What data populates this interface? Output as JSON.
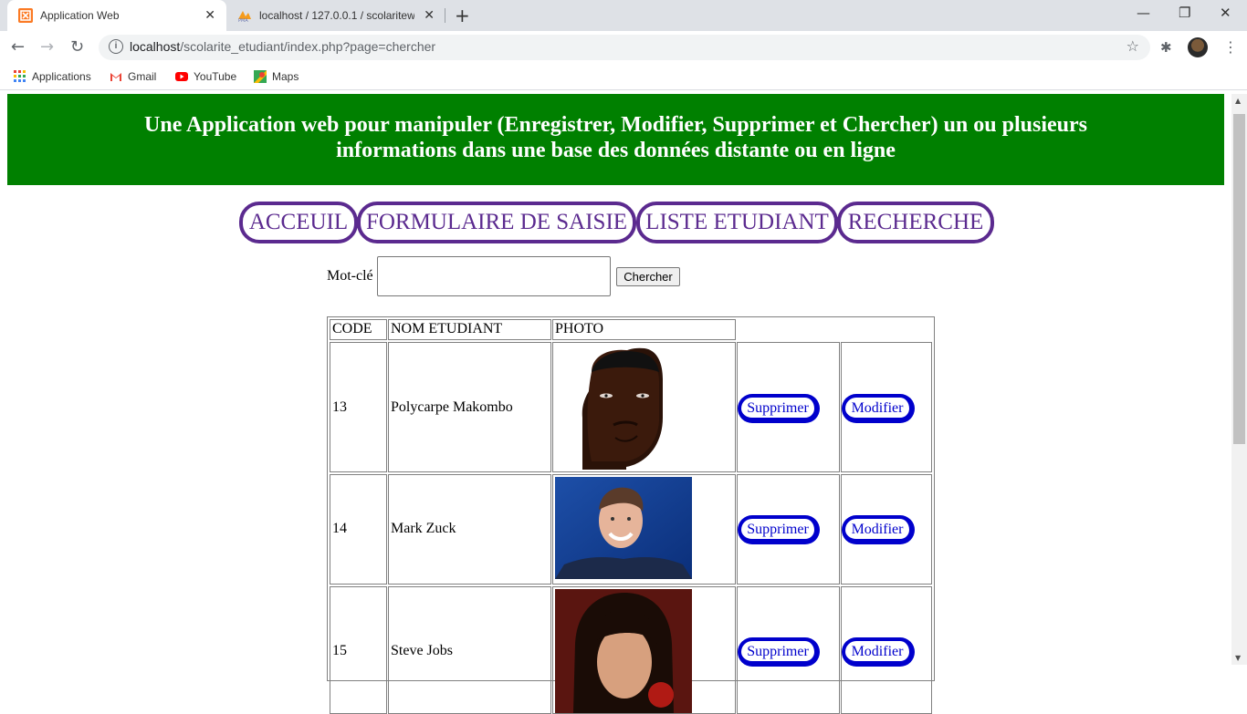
{
  "browser": {
    "tabs": [
      {
        "title": "Application Web",
        "active": true,
        "favicon": "xampp-icon"
      },
      {
        "title": "localhost / 127.0.0.1 / scolaritewe",
        "active": false,
        "favicon": "phpmyadmin-icon"
      }
    ],
    "url_host": "localhost",
    "url_path": "/scolarite_etudiant/index.php?page=chercher",
    "bookmarks": [
      {
        "label": "Applications",
        "icon": "apps-grid-icon"
      },
      {
        "label": "Gmail",
        "icon": "gmail-icon"
      },
      {
        "label": "YouTube",
        "icon": "youtube-icon"
      },
      {
        "label": "Maps",
        "icon": "maps-icon"
      }
    ]
  },
  "page": {
    "banner_line1": "Une Application web pour manipuler (Enregistrer, Modifier, Supprimer et Chercher) un ou plusieurs",
    "banner_line2": "informations dans une base des données distante ou en ligne",
    "nav": [
      "ACCEUIL",
      "FORMULAIRE DE SAISIE",
      "LISTE ETUDIANT",
      "RECHERCHE"
    ],
    "search": {
      "label": "Mot-clé",
      "value": "",
      "button": "Chercher"
    },
    "table": {
      "headers": [
        "CODE",
        "NOM ETUDIANT",
        "PHOTO"
      ],
      "rows": [
        {
          "code": "13",
          "name": "Polycarpe Makombo",
          "delete": "Supprimer",
          "edit": "Modifier"
        },
        {
          "code": "14",
          "name": "Mark Zuck",
          "delete": "Supprimer",
          "edit": "Modifier"
        },
        {
          "code": "15",
          "name": "Steve Jobs",
          "delete": "Supprimer",
          "edit": "Modifier"
        }
      ]
    }
  },
  "colors": {
    "banner": "#008000",
    "nav_accent": "#5b2a8f",
    "action_accent": "#0000cc"
  }
}
